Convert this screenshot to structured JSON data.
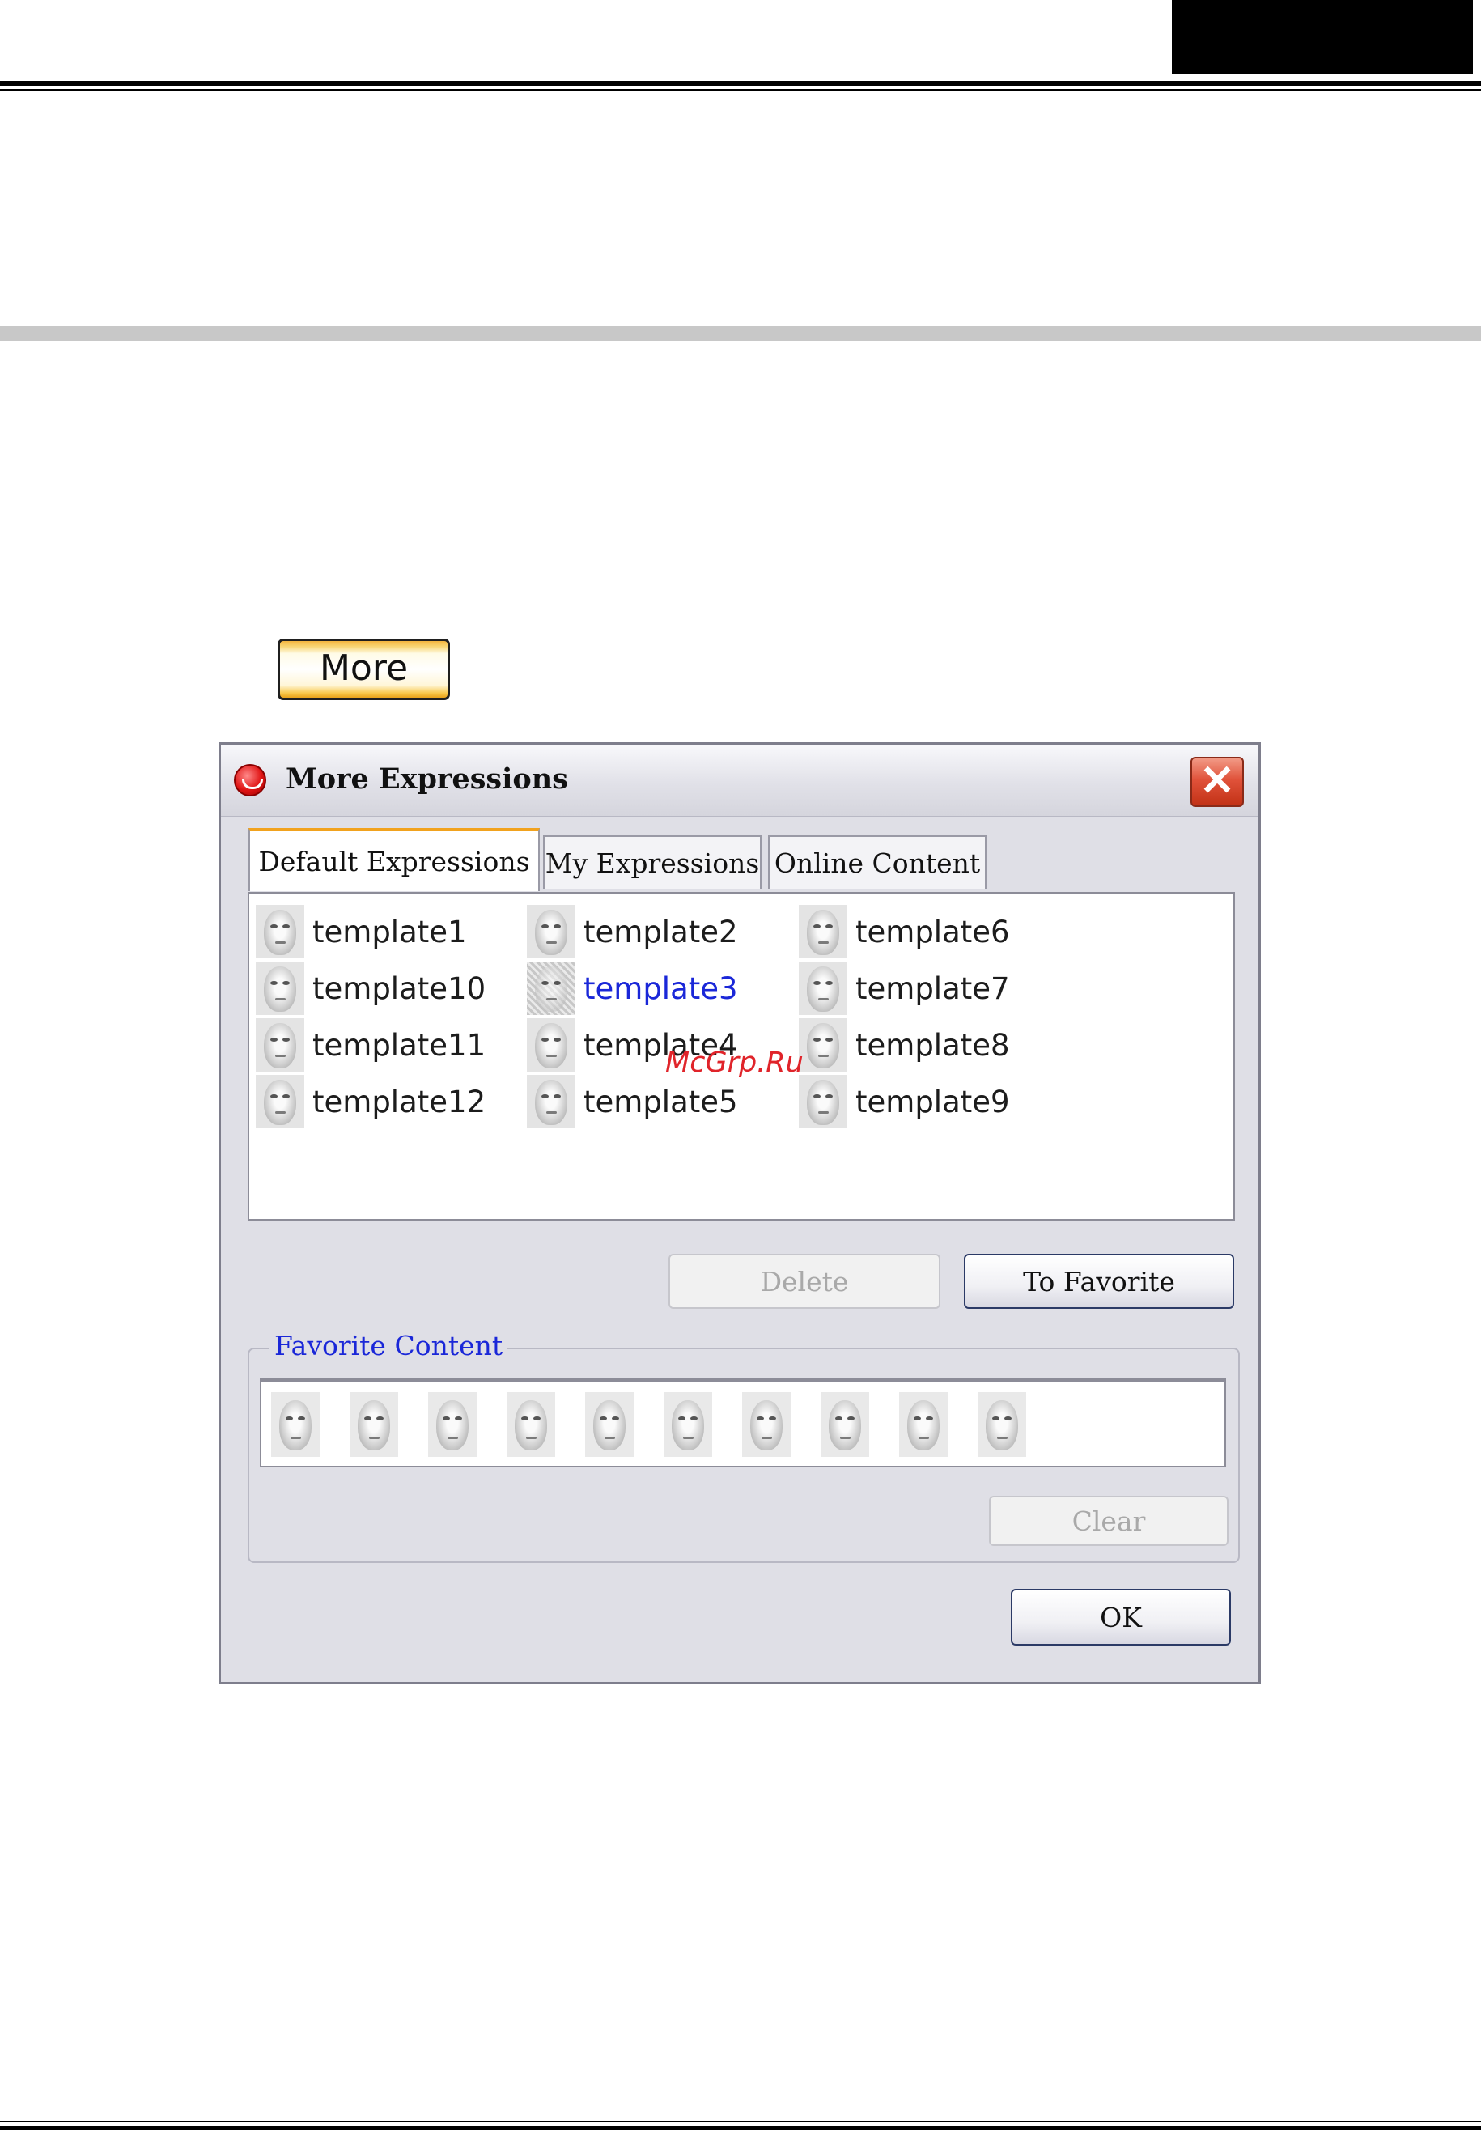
{
  "page": {
    "more_button_label": "More",
    "watermark": "McGrp.Ru"
  },
  "dialog": {
    "title": "More Expressions",
    "close_label": "✕",
    "tabs": [
      {
        "label": "Default Expressions",
        "active": true
      },
      {
        "label": "My Expressions",
        "active": false
      },
      {
        "label": "Online Content",
        "active": false
      }
    ],
    "templates": {
      "column1": [
        {
          "label": "template1"
        },
        {
          "label": "template10"
        },
        {
          "label": "template11"
        },
        {
          "label": "template12"
        }
      ],
      "column2": [
        {
          "label": "template2"
        },
        {
          "label": "template3",
          "selected": true
        },
        {
          "label": "template4"
        },
        {
          "label": "template5"
        }
      ],
      "column3": [
        {
          "label": "template6"
        },
        {
          "label": "template7"
        },
        {
          "label": "template8"
        },
        {
          "label": "template9"
        }
      ]
    },
    "delete_label": "Delete",
    "to_favorite_label": "To Favorite",
    "favorite": {
      "legend": "Favorite Content",
      "count": 10,
      "clear_label": "Clear"
    },
    "ok_label": "OK"
  },
  "colors": {
    "selected_text": "#1a27d8",
    "legend_text": "#1a27d8",
    "tab_accent": "#f1a21e",
    "close_button": "#e0523a",
    "watermark": "#e0242a"
  }
}
